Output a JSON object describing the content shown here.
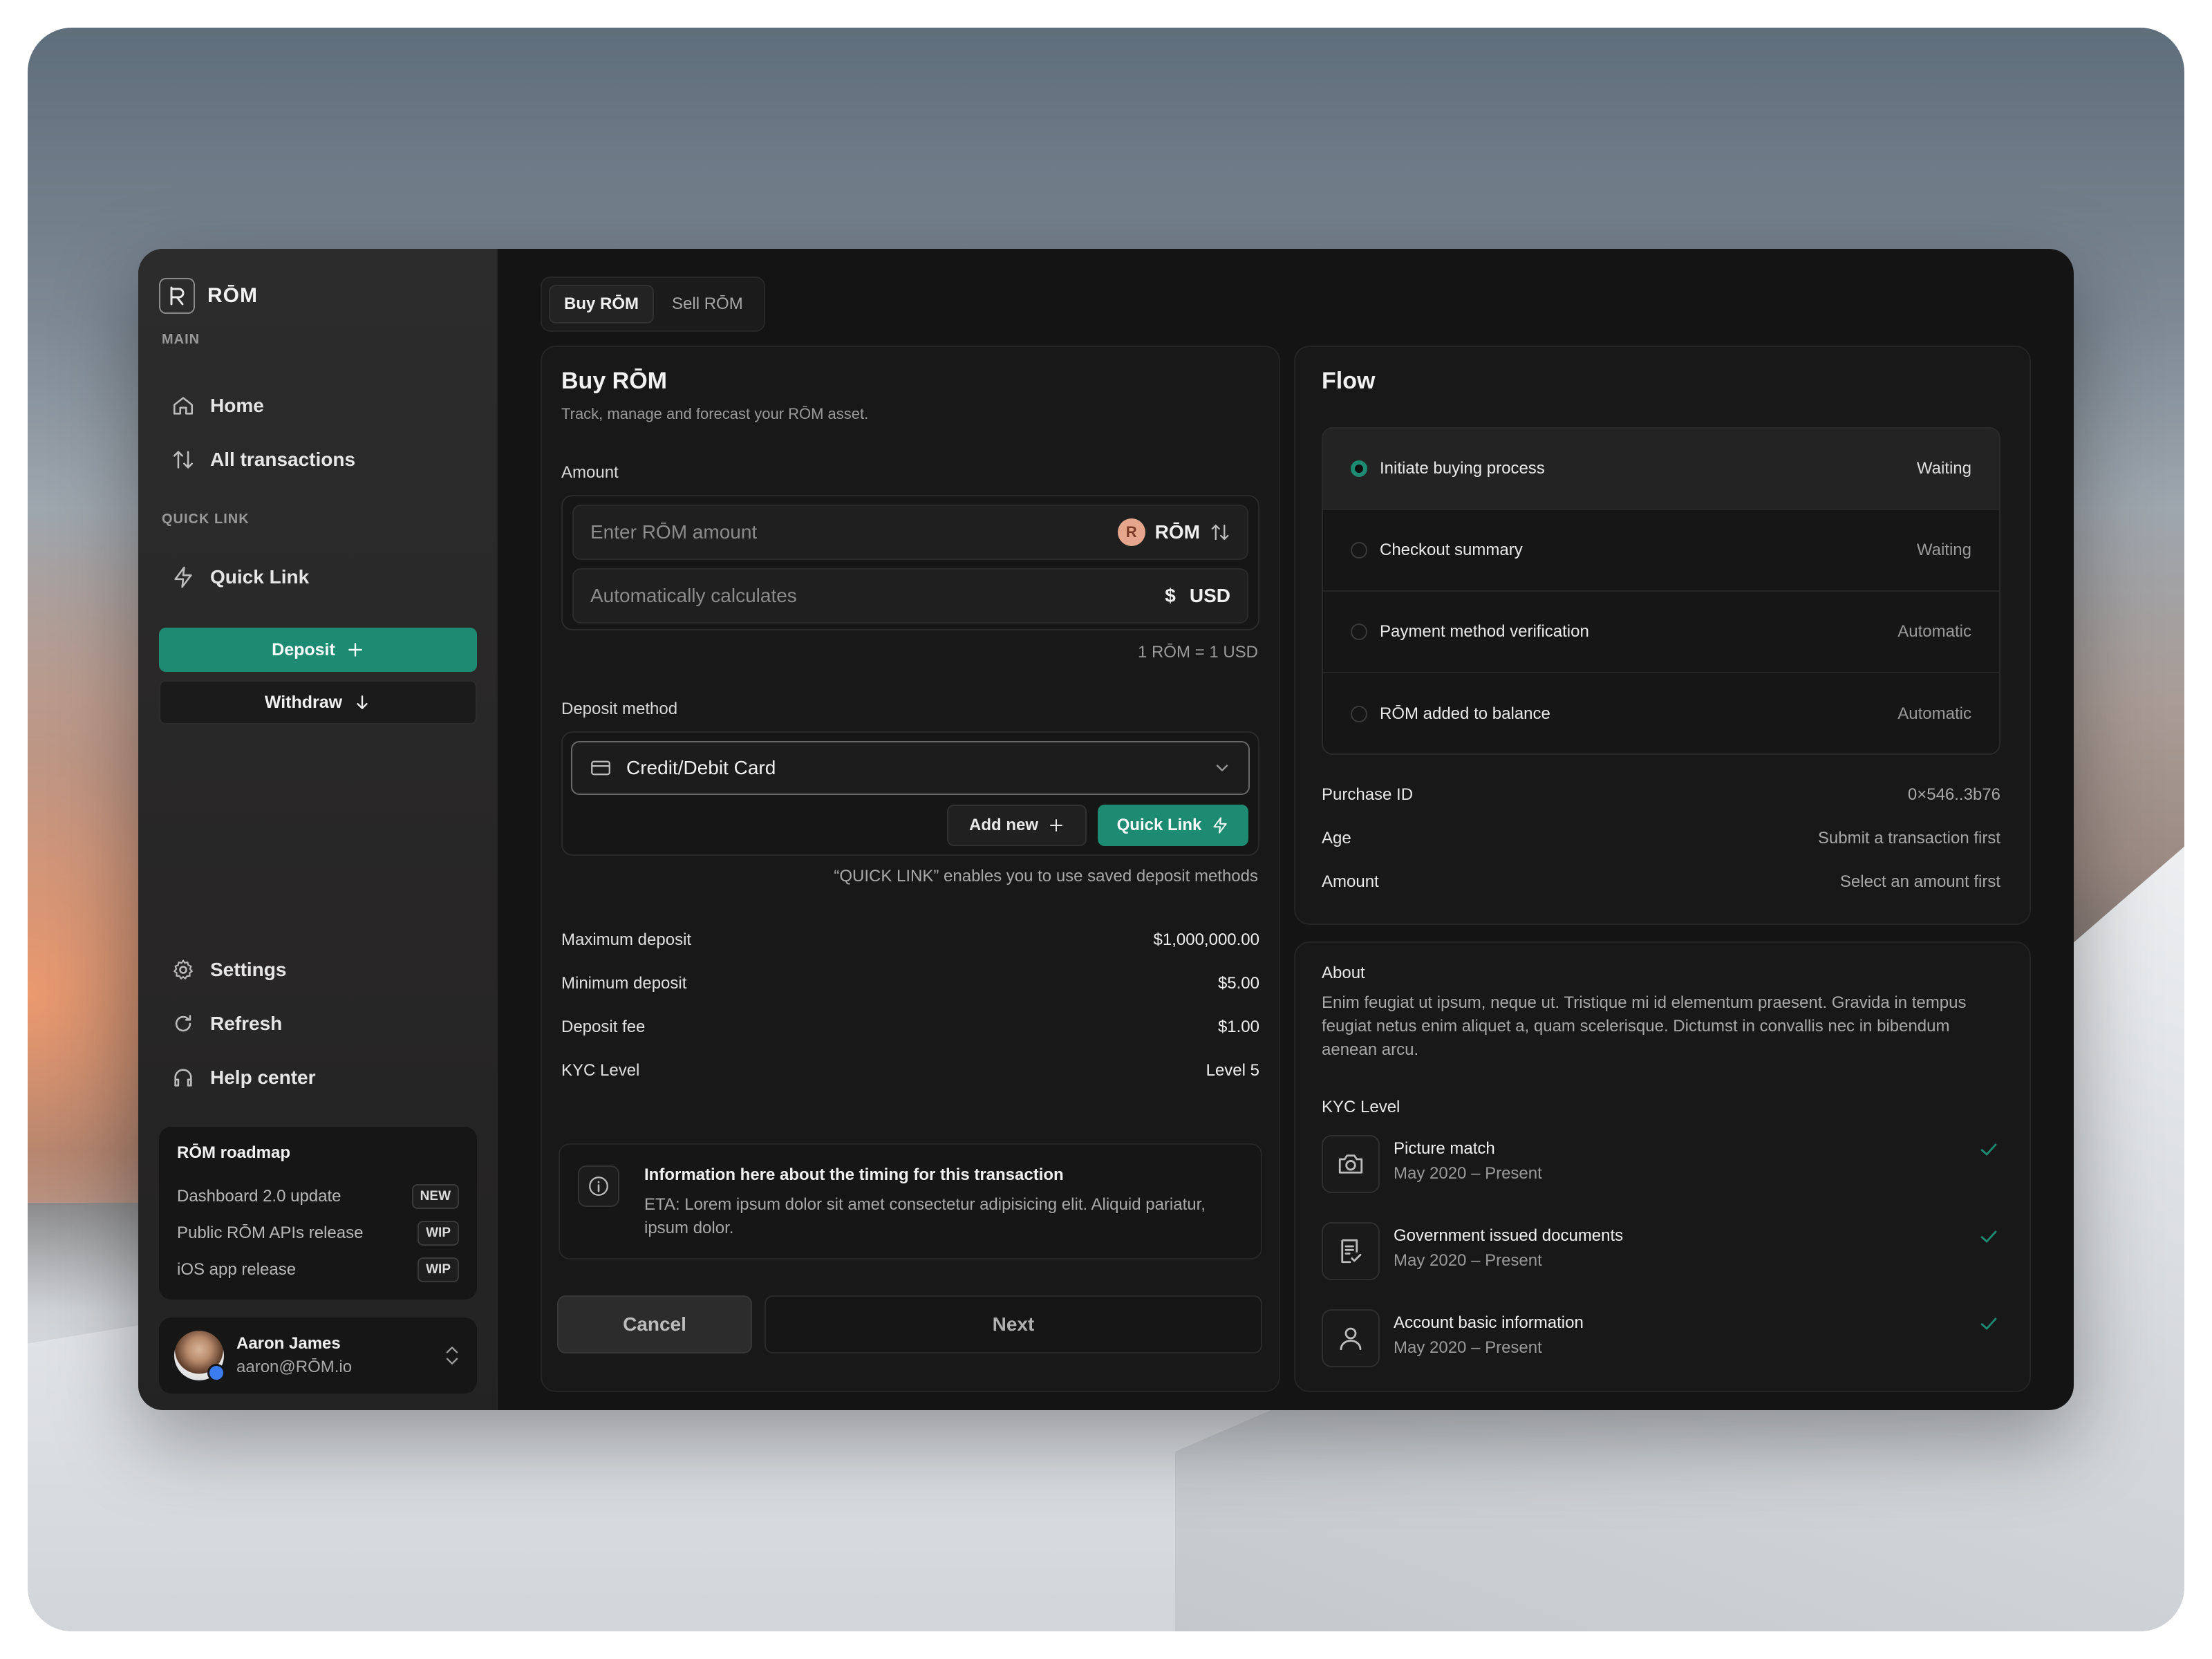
{
  "app": {
    "name": "RŌM"
  },
  "sidebar": {
    "main_label": "MAIN",
    "main_items": [
      {
        "label": "Home",
        "icon": "home-icon"
      },
      {
        "label": "All transactions",
        "icon": "transfer-icon"
      }
    ],
    "quick_label": "QUICK LINK",
    "quick_items": [
      {
        "label": "Quick Link",
        "icon": "lightning-icon"
      }
    ],
    "deposit_label": "Deposit",
    "withdraw_label": "Withdraw",
    "bottom_items": [
      {
        "label": "Settings",
        "icon": "gear-icon"
      },
      {
        "label": "Refresh",
        "icon": "refresh-icon"
      },
      {
        "label": "Help center",
        "icon": "headset-icon"
      }
    ],
    "roadmap": {
      "title": "RŌM roadmap",
      "items": [
        {
          "label": "Dashboard 2.0 update",
          "badge": "NEW"
        },
        {
          "label": "Public RŌM APIs release",
          "badge": "WIP"
        },
        {
          "label": "iOS app release",
          "badge": "WIP"
        }
      ]
    },
    "user": {
      "name": "Aaron James",
      "email": "aaron@RŌM.io"
    }
  },
  "tabs": [
    {
      "label": "Buy RŌM",
      "active": true
    },
    {
      "label": "Sell RŌM",
      "active": false
    }
  ],
  "buy": {
    "title": "Buy RŌM",
    "subtitle": "Track, manage and forecast your RŌM asset.",
    "amount_label": "Amount",
    "amount_placeholder": "Enter RŌM amount",
    "amount_currency": "RŌM",
    "usd_placeholder": "Automatically calculates",
    "usd_symbol": "$",
    "usd_currency": "USD",
    "rate": "1 RŌM = 1 USD",
    "method_label": "Deposit method",
    "method_value": "Credit/Debit Card",
    "add_new_label": "Add new",
    "quick_link_label": "Quick Link",
    "quick_link_note": "“QUICK LINK” enables you to use saved deposit methods",
    "info_rows": [
      {
        "label": "Maximum deposit",
        "value": "$1,000,000.00"
      },
      {
        "label": "Minimum deposit",
        "value": "$5.00"
      },
      {
        "label": "Deposit fee",
        "value": "$1.00"
      },
      {
        "label": "KYC Level",
        "value": "Level 5"
      }
    ],
    "notice_title": "Information here about the timing for this transaction",
    "notice_text": "ETA: Lorem ipsum dolor sit amet consectetur adipisicing elit. Aliquid pariatur, ipsum dolor.",
    "cancel_label": "Cancel",
    "next_label": "Next"
  },
  "flow": {
    "title": "Flow",
    "steps": [
      {
        "label": "Initiate buying process",
        "status": "Waiting",
        "active": true
      },
      {
        "label": "Checkout summary",
        "status": "Waiting",
        "active": false
      },
      {
        "label": "Payment method verification",
        "status": "Automatic",
        "active": false
      },
      {
        "label": "RŌM added to balance",
        "status": "Automatic",
        "active": false
      }
    ],
    "meta": [
      {
        "label": "Purchase ID",
        "value": "0×546..3b76"
      },
      {
        "label": "Age",
        "value": "Submit a transaction first"
      },
      {
        "label": "Amount",
        "value": "Select an amount first"
      }
    ]
  },
  "about": {
    "title": "About",
    "text": "Enim feugiat ut ipsum, neque ut. Tristique mi id elementum praesent. Gravida in tempus feugiat netus enim aliquet a, quam scelerisque. Dictumst in convallis nec in bibendum aenean arcu.",
    "kyc_label": "KYC Level",
    "kyc_items": [
      {
        "name": "Picture match",
        "date": "May 2020 – Present",
        "icon": "camera-icon"
      },
      {
        "name": "Government issued documents",
        "date": "May 2020 – Present",
        "icon": "document-icon"
      },
      {
        "name": "Account basic information",
        "date": "May 2020 – Present",
        "icon": "user-icon"
      }
    ]
  },
  "colors": {
    "accent": "#1d8a72",
    "background": "#141414",
    "sidebar": "#2b2a2a"
  }
}
